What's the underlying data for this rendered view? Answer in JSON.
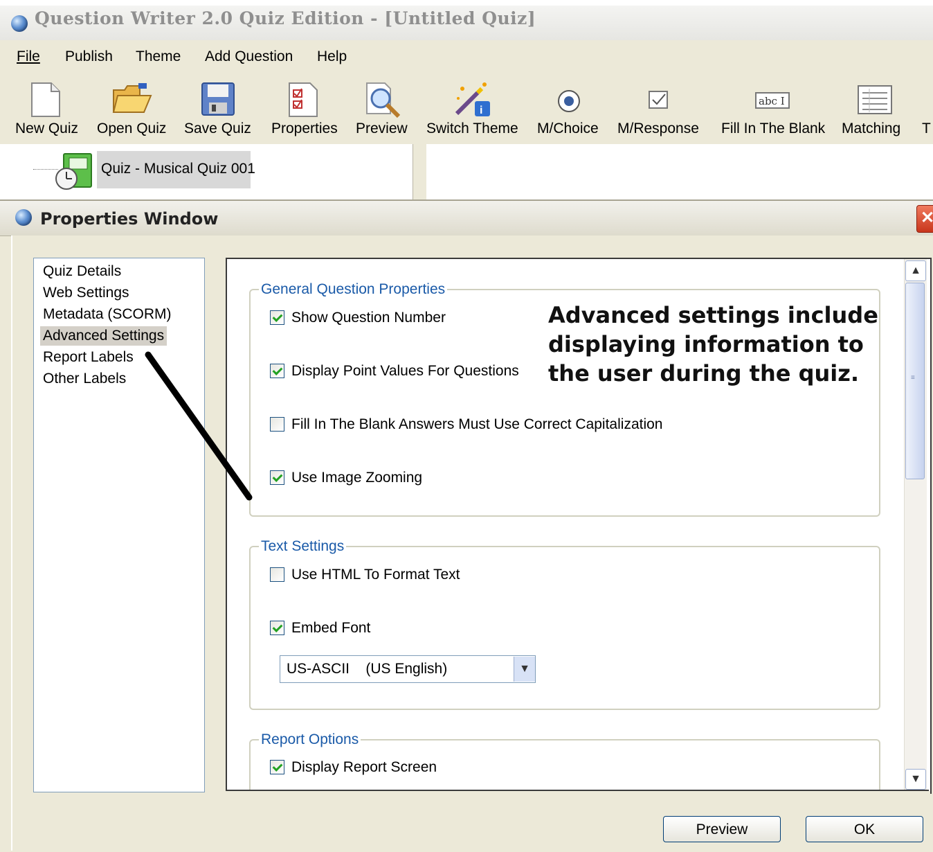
{
  "app": {
    "title": "Question Writer 2.0 Quiz Edition - [Untitled Quiz]"
  },
  "menu": {
    "items": [
      "File",
      "Publish",
      "Theme",
      "Add Question",
      "Help"
    ]
  },
  "toolbar": {
    "items": [
      "New Quiz",
      "Open Quiz",
      "Save Quiz",
      "Properties",
      "Preview",
      "Switch Theme",
      "M/Choice",
      "M/Response",
      "Fill In The Blank",
      "Matching",
      "T"
    ]
  },
  "tree": {
    "node_label": "Quiz - Musical Quiz 001"
  },
  "dialog": {
    "title": "Properties Window",
    "nav": {
      "items": [
        "Quiz Details",
        "Web Settings",
        "Metadata (SCORM)",
        "Advanced Settings",
        "Report Labels",
        "Other Labels"
      ],
      "selected": "Advanced Settings"
    },
    "groups": {
      "general": {
        "legend": "General Question Properties",
        "options": [
          {
            "label": "Show Question Number",
            "checked": true
          },
          {
            "label": "Display Point Values For Questions",
            "checked": true
          },
          {
            "label": "Fill In The Blank Answers Must Use Correct Capitalization",
            "checked": false
          },
          {
            "label": "Use Image Zooming",
            "checked": true
          }
        ]
      },
      "text": {
        "legend": "Text Settings",
        "options": [
          {
            "label": "Use HTML To Format Text",
            "checked": false
          },
          {
            "label": "Embed Font",
            "checked": true
          }
        ],
        "font_select": "US-ASCII    (US English)"
      },
      "report": {
        "legend": "Report Options",
        "options": [
          {
            "label": "Display Report Screen",
            "checked": true
          }
        ]
      }
    },
    "annotation": "Advanced settings include displaying information to the user during the quiz.",
    "buttons": {
      "preview": "Preview",
      "ok": "OK"
    }
  },
  "colors": {
    "chrome": "#ece9d8",
    "legend_blue": "#1a5aa8",
    "check_green": "#21a121"
  }
}
